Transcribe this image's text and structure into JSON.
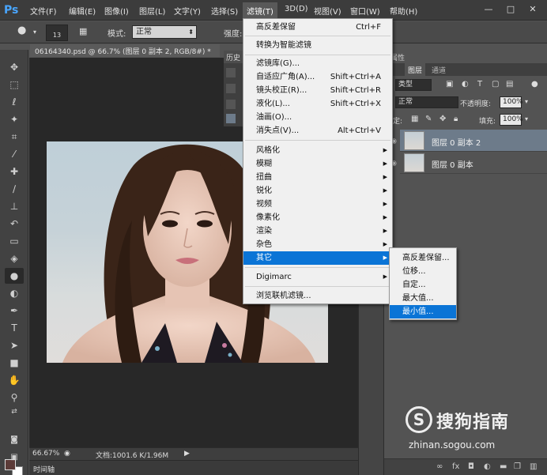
{
  "app": {
    "logo": "Ps"
  },
  "menubar": {
    "items": [
      "文件(F)",
      "编辑(E)",
      "图像(I)",
      "图层(L)",
      "文字(Y)",
      "选择(S)",
      "滤镜(T)",
      "3D(D)",
      "视图(V)",
      "窗口(W)",
      "帮助(H)"
    ],
    "active_index": 6,
    "window_controls": [
      "—",
      "□",
      "✕"
    ]
  },
  "options_bar": {
    "brush_size": "13",
    "mode_label": "模式:",
    "mode_value": "正常",
    "strength_label": "强度:"
  },
  "document": {
    "tab_title": "06164340.psd @ 66.7% (图层 0 副本 2, RGB/8#) *",
    "zoom": "66.67%",
    "doc_size": "文档:1001.6 K/1.96M",
    "timeline_label": "时间轴"
  },
  "history_panel": {
    "tab_label": "历史"
  },
  "layers_panel": {
    "properties_tab": "属性",
    "tabs": [
      "图层",
      "通道"
    ],
    "kind_label": "类型",
    "blend_mode": "正常",
    "opacity_label": "不透明度:",
    "opacity_value": "100%",
    "lock_label": "锁定:",
    "fill_label": "填充:",
    "fill_value": "100%",
    "layers": [
      {
        "name": "图层 0 副本 2",
        "selected": true
      },
      {
        "name": "图层 0 副本",
        "selected": false
      }
    ],
    "bottom_icons": [
      "link-icon",
      "fx-icon",
      "mask-icon",
      "adjustment-icon",
      "folder-icon",
      "new-layer-icon",
      "trash-icon"
    ]
  },
  "filter_menu": {
    "items": [
      {
        "label": "高反差保留",
        "shortcut": "Ctrl+F"
      },
      {
        "label": "转换为智能滤镜",
        "shortcut": ""
      },
      {
        "label": "滤镜库(G)...",
        "shortcut": ""
      },
      {
        "label": "自适应广角(A)...",
        "shortcut": "Shift+Ctrl+A"
      },
      {
        "label": "镜头校正(R)...",
        "shortcut": "Shift+Ctrl+R"
      },
      {
        "label": "液化(L)...",
        "shortcut": "Shift+Ctrl+X"
      },
      {
        "label": "油画(O)...",
        "shortcut": ""
      },
      {
        "label": "消失点(V)...",
        "shortcut": "Alt+Ctrl+V"
      },
      {
        "label": "风格化",
        "submenu": true
      },
      {
        "label": "模糊",
        "submenu": true
      },
      {
        "label": "扭曲",
        "submenu": true
      },
      {
        "label": "锐化",
        "submenu": true
      },
      {
        "label": "视频",
        "submenu": true
      },
      {
        "label": "像素化",
        "submenu": true
      },
      {
        "label": "渲染",
        "submenu": true
      },
      {
        "label": "杂色",
        "submenu": true
      },
      {
        "label": "其它",
        "submenu": true,
        "highlighted": true
      },
      {
        "label": "Digimarc",
        "submenu": true
      },
      {
        "label": "浏览联机滤镜...",
        "shortcut": ""
      }
    ]
  },
  "other_submenu": {
    "items": [
      {
        "label": "高反差保留..."
      },
      {
        "label": "位移..."
      },
      {
        "label": "自定..."
      },
      {
        "label": "最大值..."
      },
      {
        "label": "最小值...",
        "highlighted": true
      }
    ]
  },
  "watermark": {
    "logo_letter": "S",
    "text": "搜狗指南",
    "url": "zhinan.sogou.com"
  },
  "colors": {
    "accent": "#0a74d6",
    "foreground_swatch": "#5c3b38",
    "background_swatch": "#ffffff",
    "layer_selected": "#6d7b8a"
  }
}
